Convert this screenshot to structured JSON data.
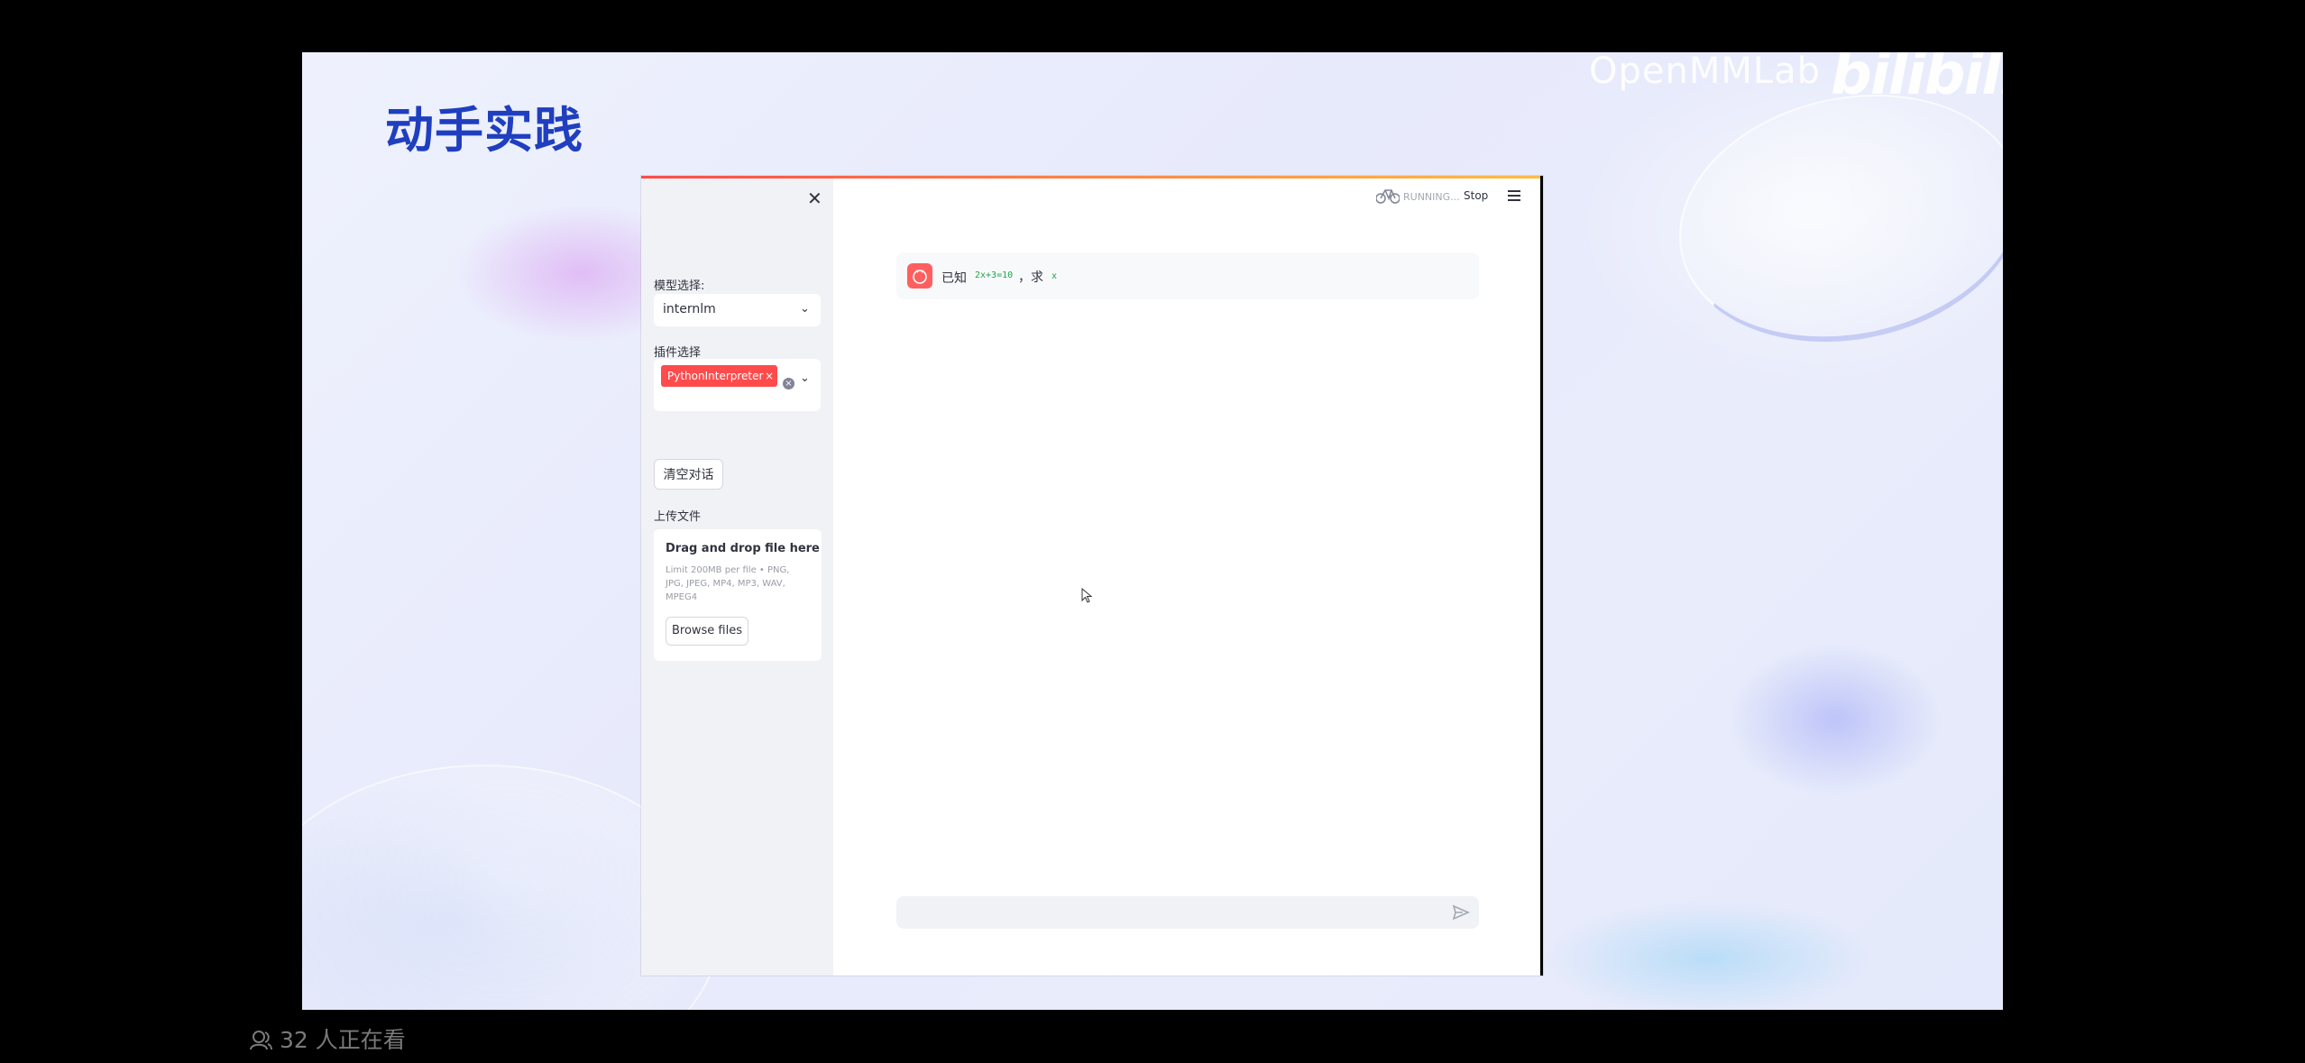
{
  "slide": {
    "title": "动手实践",
    "watermark": "OpenMMLab",
    "bilibili": "bilibili"
  },
  "app": {
    "sidebar": {
      "close_icon": "✕",
      "model_label": "模型选择:",
      "model_value": "internlm",
      "plugin_label": "插件选择",
      "plugin_tag": "PythonInterpreter",
      "clear_button": "清空对话",
      "upload_label": "上传文件",
      "upload": {
        "title": "Drag and drop file here",
        "hint": "Limit 200MB per file • PNG, JPG, JPEG, MP4, MP3, WAV, MPEG4",
        "browse_button": "Browse files"
      }
    },
    "header": {
      "status": "RUNNING...",
      "stop_button": "Stop"
    },
    "chat": {
      "message_prefix": "已知",
      "message_code": "2x+3=10",
      "message_mid": "，求",
      "message_var": "x"
    },
    "colors": {
      "accent": "#ff4b4b",
      "sidebar_bg": "#f0f2f6"
    }
  },
  "footer": {
    "viewers": "32 人正在看"
  }
}
